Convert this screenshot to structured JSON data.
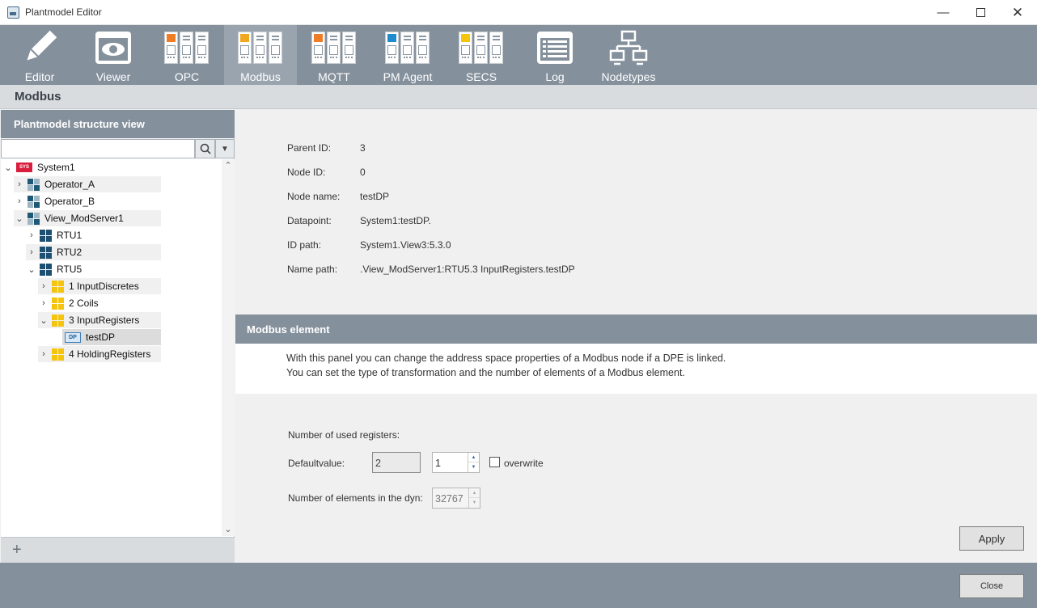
{
  "window": {
    "title": "Plantmodel Editor"
  },
  "toolbar": {
    "items": [
      {
        "label": "Editor",
        "icon": "pen-icon"
      },
      {
        "label": "Viewer",
        "icon": "eye-icon"
      },
      {
        "label": "OPC",
        "icon": "module-icon",
        "accent": "#f07d25"
      },
      {
        "label": "Modbus",
        "icon": "module-icon",
        "accent": "#f0a820",
        "active": true
      },
      {
        "label": "MQTT",
        "icon": "module-icon",
        "accent": "#f07d25"
      },
      {
        "label": "PM Agent",
        "icon": "module-icon",
        "accent": "#1e8ccc"
      },
      {
        "label": "SECS",
        "icon": "module-icon",
        "accent": "#f4c40f"
      },
      {
        "label": "Log",
        "icon": "log-icon"
      },
      {
        "label": "Nodetypes",
        "icon": "network-icon"
      }
    ]
  },
  "page": {
    "title": "Modbus"
  },
  "tree_panel": {
    "title": "Plantmodel structure view",
    "search_value": "",
    "nodes": [
      {
        "label": "System1",
        "icon": "sys-icon",
        "badge": "SYS",
        "expanded": true
      },
      {
        "label": "Operator_A",
        "icon": "operator-icon",
        "expanded": false
      },
      {
        "label": "Operator_B",
        "icon": "operator-icon",
        "expanded": false
      },
      {
        "label": "View_ModServer1",
        "icon": "operator-icon",
        "expanded": true
      },
      {
        "label": "RTU1",
        "icon": "rtu-icon",
        "expanded": false
      },
      {
        "label": "RTU2",
        "icon": "rtu-icon",
        "expanded": false
      },
      {
        "label": "RTU5",
        "icon": "rtu-icon",
        "expanded": true
      },
      {
        "label": "1 InputDiscretes",
        "icon": "group-icon",
        "expanded": false
      },
      {
        "label": "2 Coils",
        "icon": "group-icon",
        "expanded": false
      },
      {
        "label": "3 InputRegisters",
        "icon": "group-icon",
        "expanded": true
      },
      {
        "label": "testDP",
        "icon": "dp-icon",
        "badge": "DP",
        "selected": true
      },
      {
        "label": "4 HoldingRegisters",
        "icon": "group-icon",
        "expanded": false
      }
    ]
  },
  "node_info": {
    "parent_id": {
      "label": "Parent ID:",
      "value": "3"
    },
    "node_id": {
      "label": "Node ID:",
      "value": "0"
    },
    "node_name": {
      "label": "Node name:",
      "value": "testDP"
    },
    "datapoint": {
      "label": "Datapoint:",
      "value": "System1:testDP."
    },
    "id_path": {
      "label": "ID path:",
      "value": "System1.View3:5.3.0"
    },
    "name_path": {
      "label": "Name path:",
      "value": ".View_ModServer1:RTU5.3 InputRegisters.testDP"
    }
  },
  "modbus_element": {
    "title": "Modbus element",
    "description_line1": "With this panel you can change the address space properties of a Modbus node if a DPE is linked.",
    "description_line2": "You can set the type of transformation and the number of elements of a Modbus element.",
    "used_registers_label": "Number of used registers:",
    "defaultvalue_label": "Defaultvalue:",
    "defaultvalue": "2",
    "registers_value": "1",
    "overwrite_label": "overwrite",
    "overwrite_checked": false,
    "elements_label": "Number of elements in the dyn:",
    "elements_value": "32767",
    "apply_label": "Apply"
  },
  "footer": {
    "close_label": "Close"
  }
}
